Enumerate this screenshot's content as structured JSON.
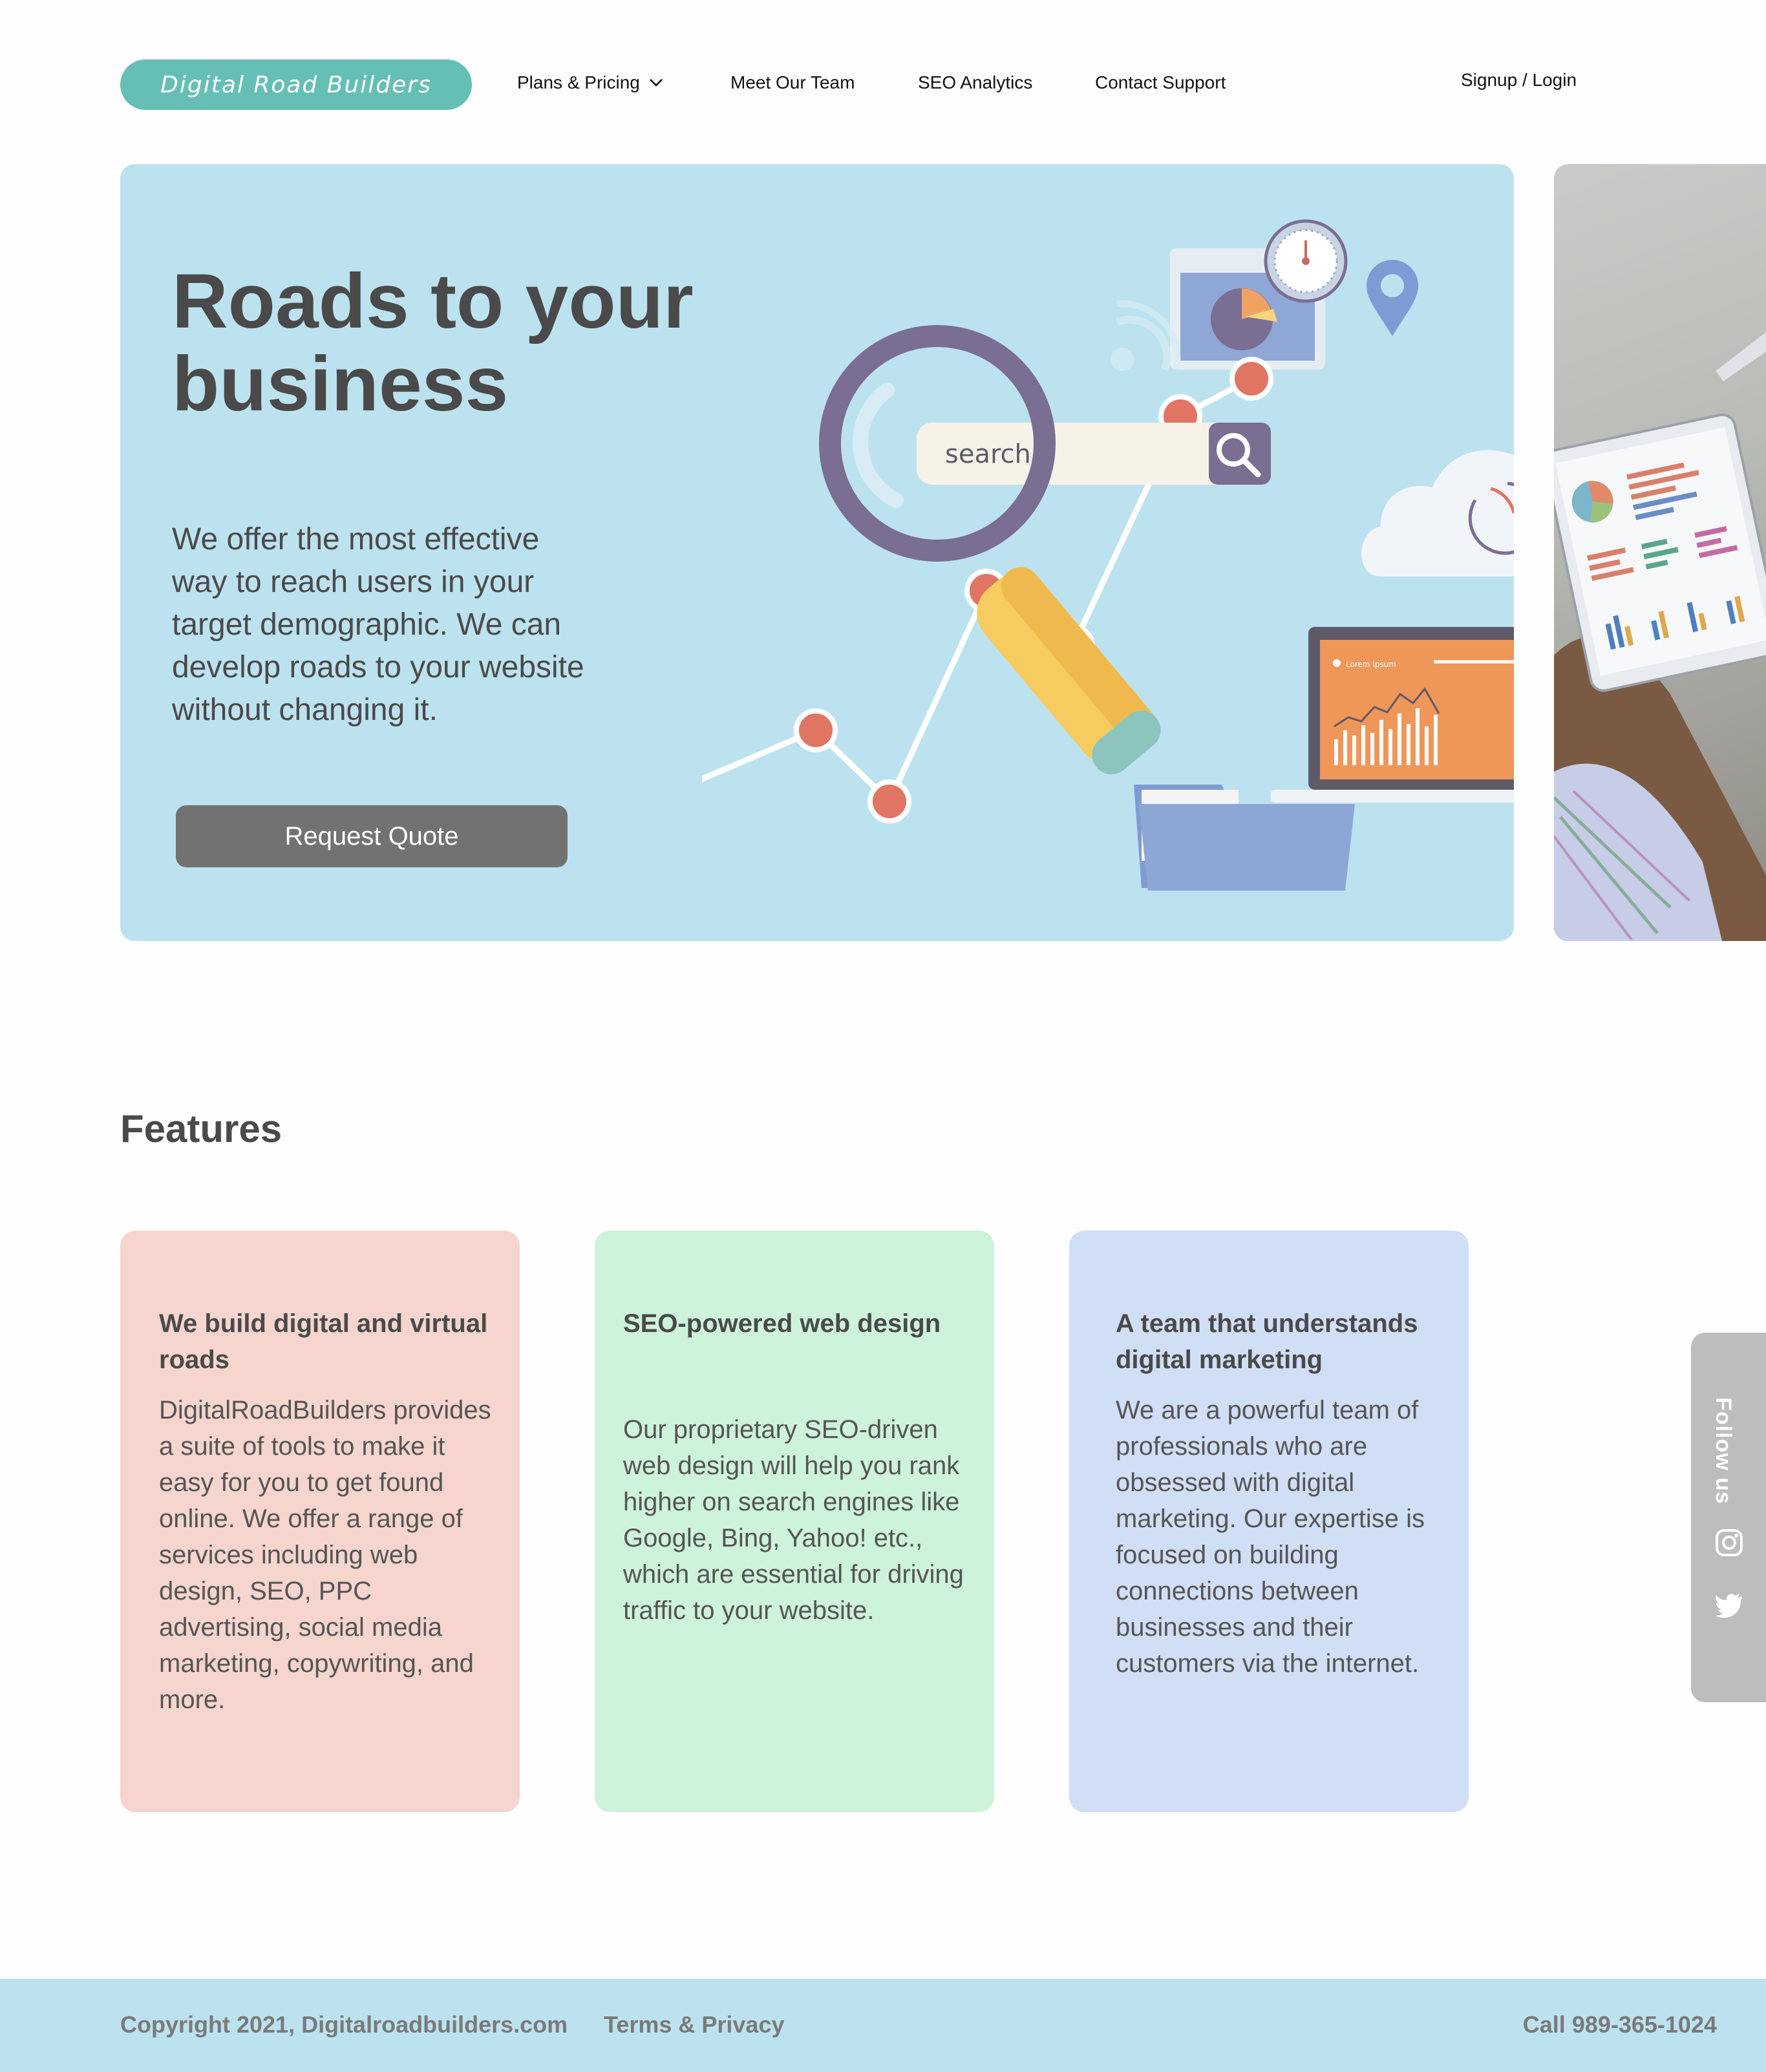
{
  "nav": {
    "logo": "Digital Road Builders",
    "items": [
      "Plans & Pricing",
      "Meet Our Team",
      "SEO Analytics",
      "Contact Support"
    ],
    "login": "Signup / Login"
  },
  "hero": {
    "title": "Roads to your business",
    "text": "We offer the most effective way to reach users in your target demographic. We can develop roads to your website without changing it.",
    "button": "Request Quote",
    "search_placeholder": "search...",
    "laptop_caption": "Lorem ipsum"
  },
  "features": {
    "title": "Features",
    "cards": [
      {
        "title": "We build digital and virtual roads",
        "text": "DigitalRoadBuilders provides a suite of tools to make it easy for you to get found online. We offer a range of services including web design, SEO, PPC advertising, social media marketing, copywriting, and more."
      },
      {
        "title": "SEO-powered web design",
        "text": "Our proprietary SEO-driven web design will help you rank higher on search engines like Google, Bing, Yahoo! etc., which are essential for driving traffic to your website."
      },
      {
        "title": "A team that understands digital marketing",
        "text": "We are a powerful team of professionals who are obsessed with digital marketing. Our expertise is focused on building connections between businesses and their customers via the internet."
      }
    ]
  },
  "follow": {
    "label": "Follow us",
    "icons": [
      "instagram-icon",
      "twitter-icon"
    ]
  },
  "footer": {
    "copyright": "Copyright 2021, Digitalroadbuilders.com",
    "terms": "Terms & Privacy",
    "phone": "Call 989-365-1024"
  },
  "colors": {
    "logo_bg": "#66bfb5",
    "hero_bg": "#bde2ef",
    "button_bg": "#727272",
    "card1_bg": "#f5d5cd",
    "card2_bg": "#cef3db",
    "card3_bg": "#d0def6",
    "follow_bg": "#bdbdbd",
    "footer_bg": "#bde2ef",
    "chart_marker": "#e07563"
  }
}
